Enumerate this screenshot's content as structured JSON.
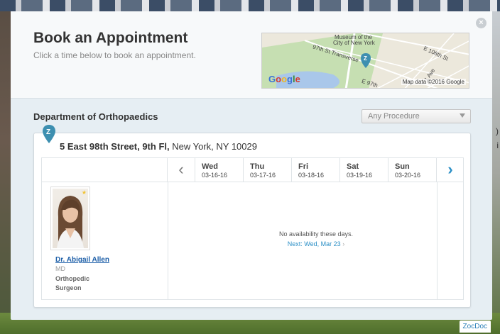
{
  "modal": {
    "title": "Book an Appointment",
    "subtitle": "Click a time below to book an appointment.",
    "close_label": "×"
  },
  "map": {
    "labels": {
      "museum_line1": "Museum of the",
      "museum_line2": "City of New York",
      "street_97": "97th St Transverse",
      "street_106": "E 106th St",
      "avenue_1": "1 Ave",
      "street_e97": "E 97th"
    },
    "brand": [
      "G",
      "o",
      "o",
      "g",
      "l",
      "e"
    ],
    "credit": "Map data ©2016 Google"
  },
  "department": {
    "title": "Department of Orthopaedics"
  },
  "procedure": {
    "selected": "Any Procedure"
  },
  "location": {
    "street": "5 East 98th Street, 9th Fl,",
    "city": "New York, NY 10029",
    "pin_label": "Z"
  },
  "schedule": {
    "prev_label": "‹",
    "next_label": "›",
    "days": [
      {
        "name": "Wed",
        "date": "03-16-16"
      },
      {
        "name": "Thu",
        "date": "03-17-16"
      },
      {
        "name": "Fri",
        "date": "03-18-16"
      },
      {
        "name": "Sat",
        "date": "03-19-16"
      },
      {
        "name": "Sun",
        "date": "03-20-16"
      }
    ],
    "no_availability": "No availability these days.",
    "next_available": "Next: Wed, Mar 23",
    "next_arrow": "›"
  },
  "doctor": {
    "name": "Dr. Abigail Allen",
    "credential": "MD",
    "specialty_line1": "Orthopedic",
    "specialty_line2": "Surgeon"
  },
  "footer": {
    "brand": "ZocDoc"
  },
  "colors": {
    "accent": "#2b8fc6",
    "link": "#1d5fa8",
    "pin": "#3d8fb0"
  }
}
